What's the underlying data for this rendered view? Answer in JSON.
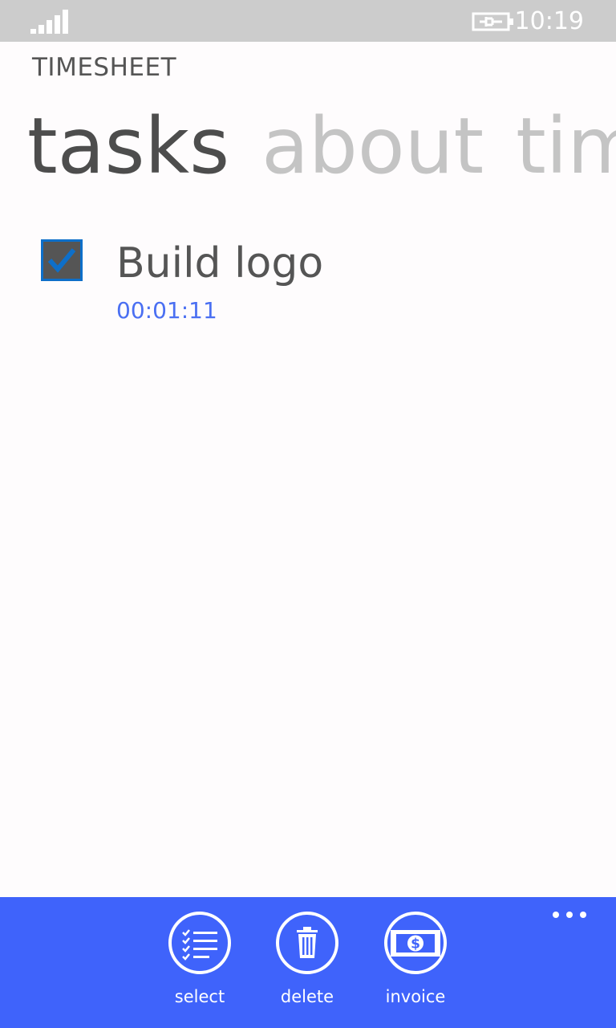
{
  "status_bar": {
    "signal_icon": "signal-strength-icon",
    "battery_icon": "battery-charging-icon",
    "time": "10:19"
  },
  "app": {
    "title": "TIMESHEET"
  },
  "pivot": {
    "headers": [
      {
        "label": "tasks",
        "active": true
      },
      {
        "label": "about",
        "active": false
      },
      {
        "label": "timesheet",
        "active": false
      }
    ]
  },
  "tasks": [
    {
      "name": "Build logo",
      "elapsed": "00:01:11",
      "checked": true
    }
  ],
  "app_bar": {
    "background": "#3f63fb",
    "buttons": [
      {
        "label": "select",
        "icon": "select-list-icon"
      },
      {
        "label": "delete",
        "icon": "trash-icon"
      },
      {
        "label": "invoice",
        "icon": "invoice-dollar-icon"
      }
    ],
    "more_icon": "more-ellipsis-icon"
  }
}
